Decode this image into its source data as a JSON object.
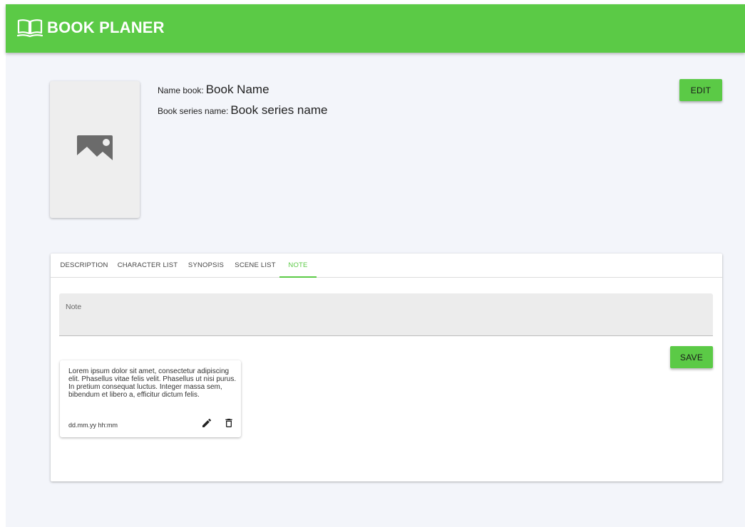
{
  "app": {
    "title": "BOOK PLANER",
    "brand_color": "#5bca46",
    "logo_icon": "book-open-icon"
  },
  "book": {
    "name_label": "Name book:",
    "name_value": "Book Name",
    "series_label": "Book series name:",
    "series_value": "Book series name",
    "cover_icon": "image-placeholder-icon"
  },
  "actions": {
    "edit_label": "EDIT",
    "save_label": "SAVE"
  },
  "tabs": [
    {
      "label": "DESCRIPTION",
      "active": false
    },
    {
      "label": "CHARACTER LIST",
      "active": false
    },
    {
      "label": "SYNOPSIS",
      "active": false
    },
    {
      "label": "SCENE LIST",
      "active": false
    },
    {
      "label": "NOTE",
      "active": true
    }
  ],
  "note_input": {
    "placeholder": "Note",
    "value": ""
  },
  "notes": [
    {
      "text": "Lorem ipsum dolor sit amet, consectetur adipiscing elit. Phasellus vitae felis velit. Phasellus ut nisi purus. In pretium consequat luctus. Integer massa sem, bibendum et libero a, efficitur dictum felis.",
      "date": "dd.mm.yy hh:mm",
      "edit_icon": "pencil-icon",
      "delete_icon": "trash-icon"
    }
  ]
}
